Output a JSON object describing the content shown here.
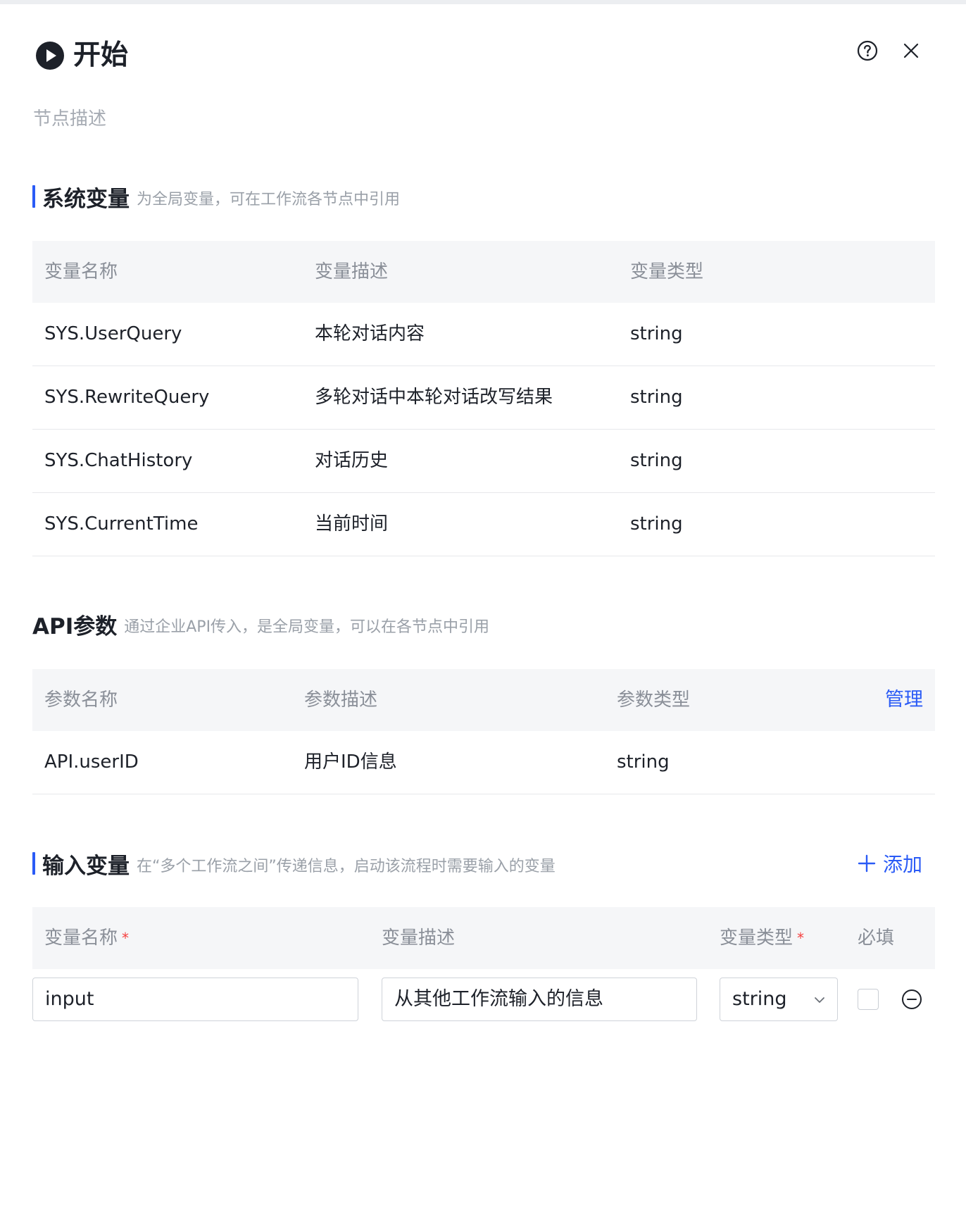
{
  "panel": {
    "title": "开始",
    "node_description_placeholder": "节点描述"
  },
  "system_variables": {
    "title": "系统变量",
    "hint": "为全局变量，可在工作流各节点中引用",
    "columns": [
      "变量名称",
      "变量描述",
      "变量类型"
    ],
    "rows": [
      {
        "name": "SYS.UserQuery",
        "desc": "本轮对话内容",
        "type": "string"
      },
      {
        "name": "SYS.RewriteQuery",
        "desc": "多轮对话中本轮对话改写结果",
        "type": "string"
      },
      {
        "name": "SYS.ChatHistory",
        "desc": "对话历史",
        "type": "string"
      },
      {
        "name": "SYS.CurrentTime",
        "desc": "当前时间",
        "type": "string"
      }
    ]
  },
  "api_params": {
    "title": "API参数",
    "hint": "通过企业API传入，是全局变量，可以在各节点中引用",
    "columns": [
      "参数名称",
      "参数描述",
      "参数类型"
    ],
    "manage_label": "管理",
    "rows": [
      {
        "name": "API.userID",
        "desc": "用户ID信息",
        "type": "string"
      }
    ]
  },
  "input_variables": {
    "title": "输入变量",
    "hint": "在“多个工作流之间”传递信息，启动该流程时需要输入的变量",
    "add_label": "添加",
    "columns": [
      "变量名称",
      "变量描述",
      "变量类型",
      "必填"
    ],
    "required_mark": "*",
    "row": {
      "name_value": "input",
      "desc_value": "从其他工作流输入的信息",
      "type_value": "string",
      "required_checked": false
    }
  },
  "colors": {
    "accent": "#2a5bf6",
    "required": "#f53f3f",
    "header_bg": "#f5f6f8"
  }
}
